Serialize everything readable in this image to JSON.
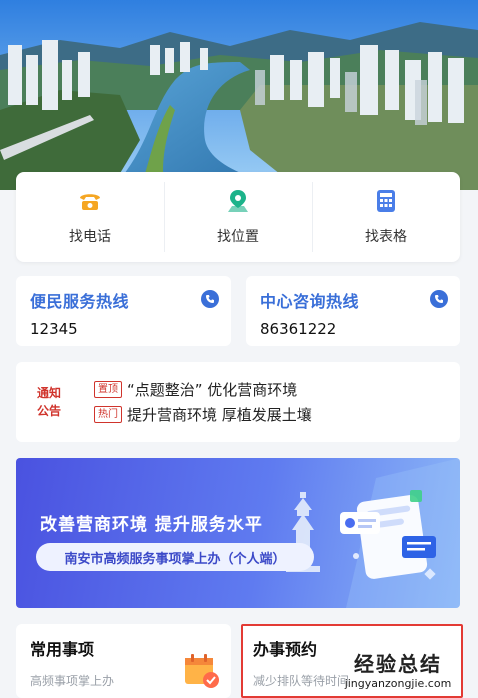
{
  "quick_actions": [
    {
      "label": "找电话",
      "icon": "phone-icon"
    },
    {
      "label": "找位置",
      "icon": "location-icon"
    },
    {
      "label": "找表格",
      "icon": "calculator-icon"
    }
  ],
  "hotlines": [
    {
      "title": "便民服务热线",
      "number": "12345"
    },
    {
      "title": "中心咨询热线",
      "number": "86361222"
    }
  ],
  "notice": {
    "logo_line1": "通知",
    "logo_line2": "公告",
    "items": [
      {
        "tag": "置顶",
        "text": "“点题整治” 优化营商环境"
      },
      {
        "tag": "热门",
        "text": "提升营商环境 厚植发展土壤"
      }
    ]
  },
  "banner": {
    "title": "改善营商环境  提升服务水平",
    "subtitle": "南安市高频服务事项掌上办（个人端）"
  },
  "cards": [
    {
      "title": "常用事项",
      "subtitle": "高频事项掌上办",
      "icon": "calendar-check-icon"
    },
    {
      "title": "办事预约",
      "subtitle": "减少排队等待时间",
      "icon": "appointment-icon"
    }
  ],
  "watermark": {
    "main": "经验总结",
    "url": "jingyanzongjie.com"
  },
  "colors": {
    "accent_blue": "#3a6fd8",
    "notice_red": "#d0342c",
    "highlight_border": "#e33a34"
  }
}
